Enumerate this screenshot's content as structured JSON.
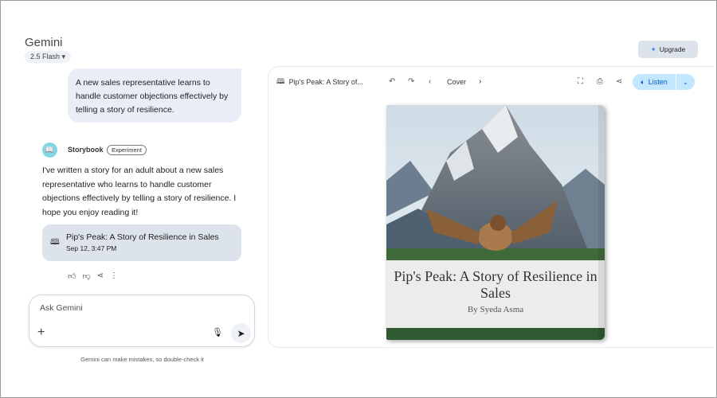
{
  "app": {
    "title": "Gemini",
    "model": "2.5 Flash",
    "upgrade": "Upgrade"
  },
  "chat": {
    "user_message": "A new sales representative learns to handle customer objections effectively by telling a story of resilience.",
    "agent_name": "Storybook",
    "agent_badge": "Experiment",
    "reply": "I've written a story for an adult about a new sales representative who learns to handle customer objections effectively by telling a story of resilience. I hope you enjoy reading it!",
    "card": {
      "title": "Pip's Peak: A Story of Resilience in Sales",
      "date": "Sep 12, 3:47 PM"
    },
    "input_placeholder": "Ask Gemini",
    "disclaimer": "Gemini can make mistakes, so double-check it"
  },
  "viewer": {
    "title": "Pip's Peak: A Story of...",
    "page": "Cover",
    "listen": "Listen",
    "book": {
      "title": "Pip's Peak: A Story of Resilience in Sales",
      "author": "By Syeda Asma"
    }
  }
}
